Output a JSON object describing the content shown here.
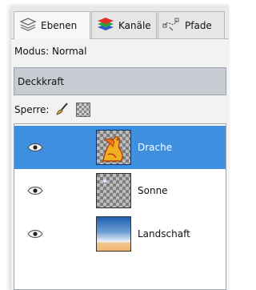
{
  "tabs": [
    {
      "label": "Ebenen",
      "icon": "layers-icon",
      "active": true
    },
    {
      "label": "Kanäle",
      "icon": "channels-icon",
      "active": false
    },
    {
      "label": "Pfade",
      "icon": "paths-icon",
      "active": false
    }
  ],
  "mode": {
    "label": "Modus: Normal"
  },
  "opacity": {
    "label": "Deckkraft"
  },
  "lock": {
    "label": "Sperre:",
    "icons": [
      "lock-pixels-brush-icon",
      "lock-alpha-checker-icon"
    ]
  },
  "layers": [
    {
      "name": "Drache",
      "selected": true,
      "visible": true,
      "thumbnail": "dragon-thumbnail"
    },
    {
      "name": "Sonne",
      "selected": false,
      "visible": true,
      "thumbnail": "sun-thumbnail"
    },
    {
      "name": "Landschaft",
      "selected": false,
      "visible": true,
      "thumbnail": "landscape-thumbnail"
    }
  ],
  "colors": {
    "selection": "#3f8fe0",
    "opacity_bar": "#c6ccd2"
  }
}
